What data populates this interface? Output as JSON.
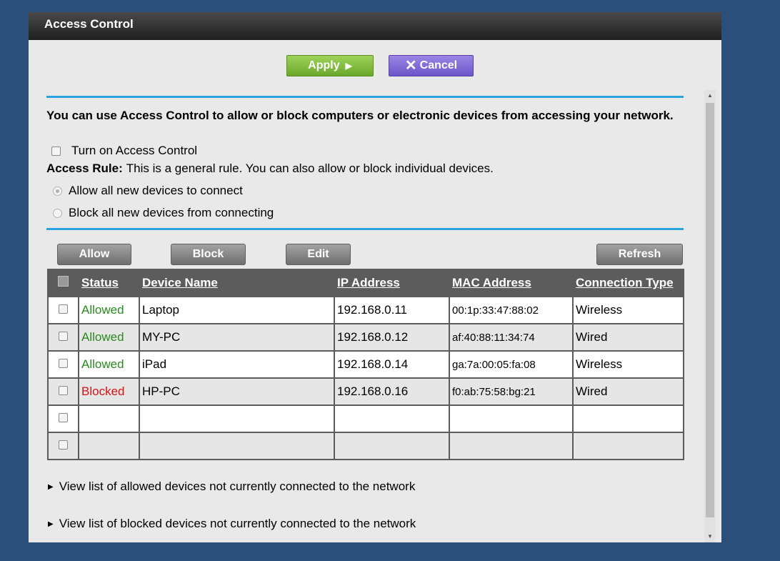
{
  "window": {
    "title": "Access Control"
  },
  "actions": {
    "apply_label": "Apply",
    "cancel_label": "Cancel"
  },
  "intro": "You can use Access Control to allow or block computers or electronic devices from accessing your network.",
  "access_control_toggle": {
    "label": "Turn on Access Control",
    "checked": false
  },
  "access_rule": {
    "label": "Access Rule:",
    "description": "This is a general rule. You can also allow or block individual devices.",
    "options": [
      {
        "label": "Allow all new devices to connect",
        "selected": true
      },
      {
        "label": "Block all new devices from connecting",
        "selected": false
      }
    ]
  },
  "toolbar": {
    "allow": "Allow",
    "block": "Block",
    "edit": "Edit",
    "refresh": "Refresh"
  },
  "table": {
    "headers": [
      "Status",
      "Device Name",
      "IP Address",
      "MAC Address",
      "Connection Type"
    ],
    "rows": [
      [
        "Allowed",
        "Laptop",
        "192.168.0.11",
        "00:1p:33:47:88:02",
        "Wireless"
      ],
      [
        "Allowed",
        "MY-PC",
        "192.168.0.12",
        "af:40:88:11:34:74",
        "Wired"
      ],
      [
        "Allowed",
        "iPad",
        "192.168.0.14",
        "ga:7a:00:05:fa:08",
        "Wireless"
      ],
      [
        "Blocked",
        "HP-PC",
        "192.168.0.16",
        "f0:ab:75:58:bg:21",
        "Wired"
      ]
    ]
  },
  "links": {
    "allowed": "View list of allowed devices not currently connected to the network",
    "blocked": "View list of blocked devices not currently connected to the network"
  },
  "colors": {
    "accent_rule": "#2aa3e0",
    "allowed": "#2a8a1e",
    "blocked": "#d41414",
    "apply": "#7bbd3a",
    "cancel": "#7b64d8"
  }
}
